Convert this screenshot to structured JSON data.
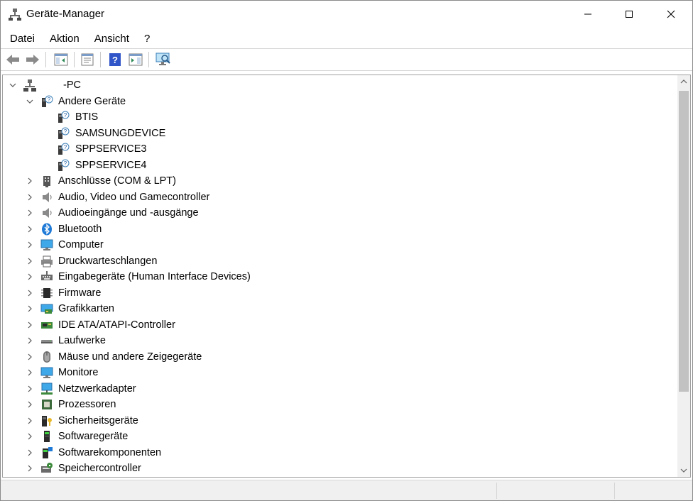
{
  "window": {
    "title": "Geräte-Manager",
    "controls": {
      "minimize": "minimize-icon",
      "maximize": "maximize-icon",
      "close": "close-icon"
    }
  },
  "menubar": {
    "items": [
      "Datei",
      "Aktion",
      "Ansicht",
      "?"
    ]
  },
  "toolbar": {
    "buttons": [
      "back-arrow-icon",
      "forward-arrow-icon",
      "show-hide-console-tree-icon",
      "properties-icon",
      "help-icon",
      "action-pane-icon",
      "scan-hardware-icon"
    ]
  },
  "tree": {
    "root": {
      "label": "-PC",
      "expanded": true
    },
    "categories": [
      {
        "label": "Andere Geräte",
        "expanded": true,
        "icon": "unknown-device-icon",
        "children": [
          "BTIS",
          "SAMSUNGDEVICE",
          "SPPSERVICE3",
          "SPPSERVICE4"
        ]
      },
      {
        "label": "Anschlüsse (COM & LPT)",
        "icon": "port-icon"
      },
      {
        "label": "Audio, Video und Gamecontroller",
        "icon": "speaker-icon"
      },
      {
        "label": "Audioeingänge und -ausgänge",
        "icon": "speaker-icon"
      },
      {
        "label": "Bluetooth",
        "icon": "bluetooth-icon"
      },
      {
        "label": "Computer",
        "icon": "monitor-icon"
      },
      {
        "label": "Druckwarteschlangen",
        "icon": "printer-icon"
      },
      {
        "label": "Eingabegeräte (Human Interface Devices)",
        "icon": "hid-icon"
      },
      {
        "label": "Firmware",
        "icon": "chip-icon"
      },
      {
        "label": "Grafikkarten",
        "icon": "display-adapter-icon"
      },
      {
        "label": "IDE ATA/ATAPI-Controller",
        "icon": "ide-controller-icon"
      },
      {
        "label": "Laufwerke",
        "icon": "disk-drive-icon"
      },
      {
        "label": "Mäuse und andere Zeigegeräte",
        "icon": "mouse-icon"
      },
      {
        "label": "Monitore",
        "icon": "monitor-icon"
      },
      {
        "label": "Netzwerkadapter",
        "icon": "network-adapter-icon"
      },
      {
        "label": "Prozessoren",
        "icon": "processor-icon"
      },
      {
        "label": "Sicherheitsgeräte",
        "icon": "security-device-icon"
      },
      {
        "label": "Softwaregeräte",
        "icon": "software-device-icon"
      },
      {
        "label": "Softwarekomponenten",
        "icon": "software-component-icon"
      },
      {
        "label": "Speichercontroller",
        "icon": "storage-controller-icon"
      }
    ]
  },
  "colors": {
    "scrollbar_thumb": "#c2c2c2",
    "statusbar_bg": "#f0f0f0",
    "bluetooth": "#1e7ad6"
  }
}
